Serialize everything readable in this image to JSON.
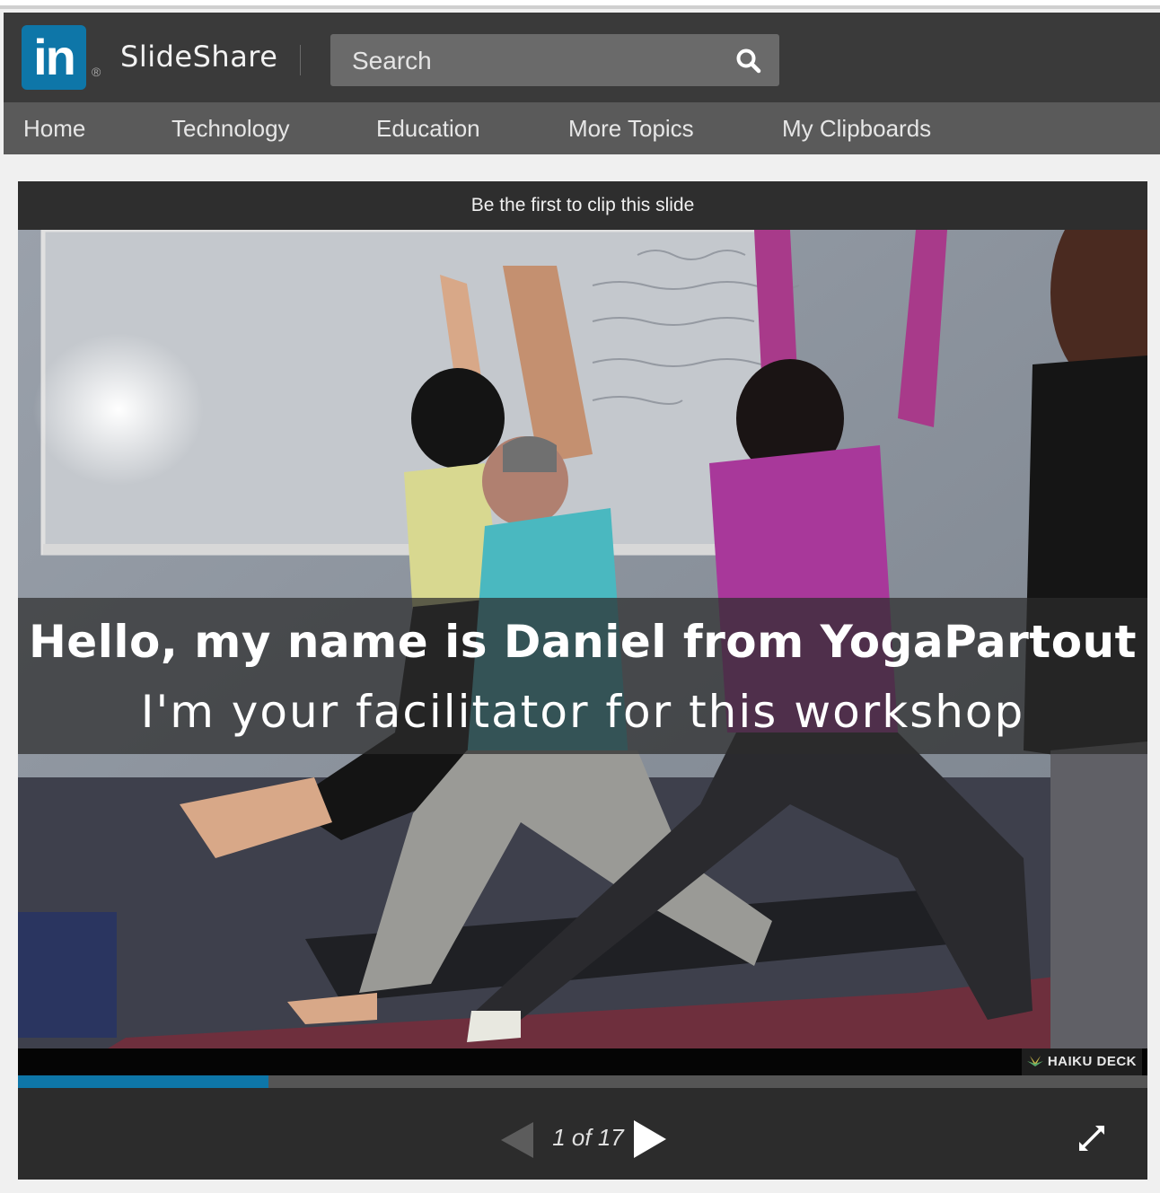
{
  "header": {
    "logo_text": "in",
    "logo_reg": "®",
    "brand": "SlideShare",
    "search_placeholder": "Search"
  },
  "nav": {
    "items": [
      {
        "label": "Home"
      },
      {
        "label": "Technology"
      },
      {
        "label": "Education"
      },
      {
        "label": "More Topics"
      },
      {
        "label": "My Clipboards"
      }
    ]
  },
  "player": {
    "clip_text": "Be the first to clip this slide",
    "caption_line1": "Hello, my name is Daniel from YogaPartout",
    "caption_line2": "I'm your facilitator for this workshop",
    "watermark": "HAIKU DECK",
    "page_counter": "1 of 17",
    "current_slide": 1,
    "total_slides": 17,
    "progress_fraction": 0.222
  },
  "colors": {
    "accent": "#0e76a8",
    "header_bg": "#3a3a3a",
    "nav_bg": "#5a5a5a"
  }
}
